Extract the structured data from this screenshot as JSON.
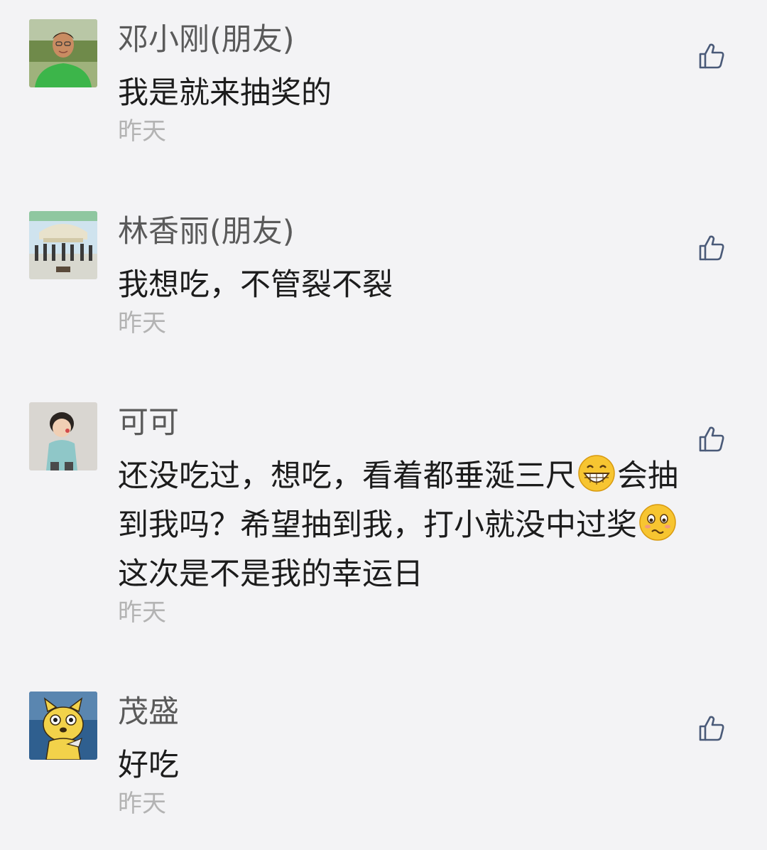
{
  "comments": [
    {
      "avatar": "avatar-man-green-shirt",
      "name": "邓小刚(朋友)",
      "lines": [
        "我是就来抽奖的"
      ],
      "time": "昨天",
      "like_icon": "thumbs-up-icon"
    },
    {
      "avatar": "avatar-group-photo",
      "name": "林香丽(朋友)",
      "lines": [
        "我想吃，不管裂不裂"
      ],
      "time": "昨天",
      "like_icon": "thumbs-up-icon"
    },
    {
      "avatar": "avatar-child",
      "name": "可可",
      "line1a": "还没吃过，想吃，看着都垂涎三尺",
      "line1b": "会抽",
      "line2": "到我吗？希望抽到我，打小就没中过奖",
      "line3": "这次是不是我的幸运日",
      "emojis": [
        "grin-emoji",
        "worried-emoji"
      ],
      "time": "昨天",
      "like_icon": "thumbs-up-icon"
    },
    {
      "avatar": "avatar-cartoon-dog",
      "name": "茂盛",
      "lines": [
        "好吃"
      ],
      "time": "昨天",
      "like_icon": "thumbs-up-icon"
    }
  ],
  "colors": {
    "background": "#f3f3f5",
    "name": "#5a5a5a",
    "text": "#1c1c1c",
    "time": "#b3b3b3",
    "icon": "#4a5a78"
  }
}
